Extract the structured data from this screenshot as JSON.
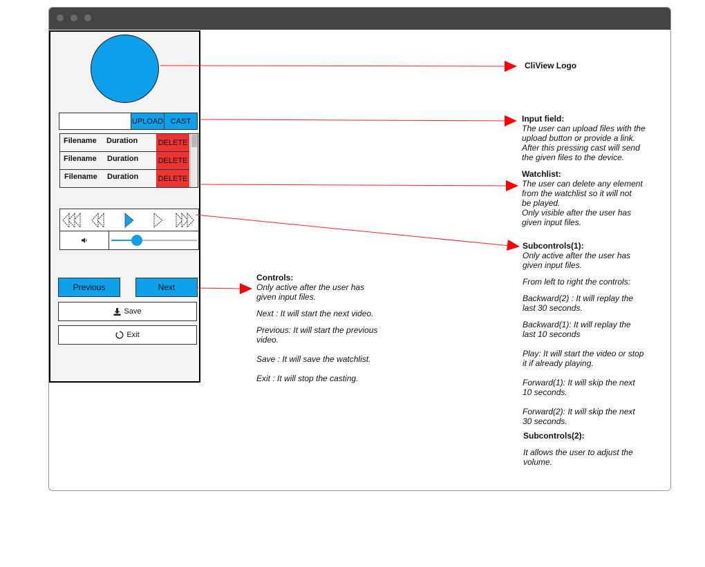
{
  "app": {
    "phone": {
      "upload_label": "UPLOAD",
      "cast_label": "CAST",
      "watchlist": {
        "rows": [
          {
            "filename": "Filename",
            "duration": "Duration",
            "delete_label": "DELETE"
          },
          {
            "filename": "Filename",
            "duration": "Duration",
            "delete_label": "DELETE"
          },
          {
            "filename": "Filename",
            "duration": "Duration",
            "delete_label": "DELETE"
          }
        ]
      },
      "volume_level": 0.3,
      "previous_label": "Previous",
      "next_label": "Next",
      "save_label": "Save",
      "exit_label": "Exit"
    }
  },
  "annotations": {
    "logo": "CliView Logo",
    "input": {
      "title": "Input field:",
      "lines": [
        "The user can upload files with the",
        "upload button or provide a link.",
        "After this pressing cast will send",
        "the given files to the device."
      ]
    },
    "watchlist": {
      "title": "Watchlist:",
      "lines": [
        "The user can delete any element",
        "from the watchlist so it will not",
        "be played.",
        "Only visible after the user has",
        "given input files."
      ]
    },
    "subcontrols1": {
      "title": "Subcontrols(1):",
      "lines": [
        "Only active after the user has",
        "given input files."
      ],
      "intro": "From left to right the controls:",
      "items": [
        [
          "Backward(2) : It will replay the",
          "last 30 seconds."
        ],
        [
          "Backward(1): It will replay the",
          "last 10 seconds"
        ],
        [
          "Play: It will start the video or stop",
          "it if already playing."
        ],
        [
          "Forward(1): It will skip the next",
          "10 seconds."
        ],
        [
          "Forward(2): It will skip the next",
          "30 seconds."
        ]
      ]
    },
    "subcontrols2": {
      "title": "Subcontrols(2):",
      "lines": [
        "It allows the user to adjust the",
        "volume."
      ]
    },
    "controls": {
      "title": "Controls:",
      "lines": [
        "Only active after the user has",
        "given input files."
      ],
      "next": "Next : It will start the next video.",
      "previous": [
        "Previous: It will start the previous",
        "video."
      ],
      "save": "Save : It will save the watchlist.",
      "exit": "Exit : It will stop the casting."
    }
  },
  "colors": {
    "accent": "#0ea0ea",
    "delete": "#ee3333",
    "arrow": "#ff0000",
    "titlebar": "#444444"
  }
}
